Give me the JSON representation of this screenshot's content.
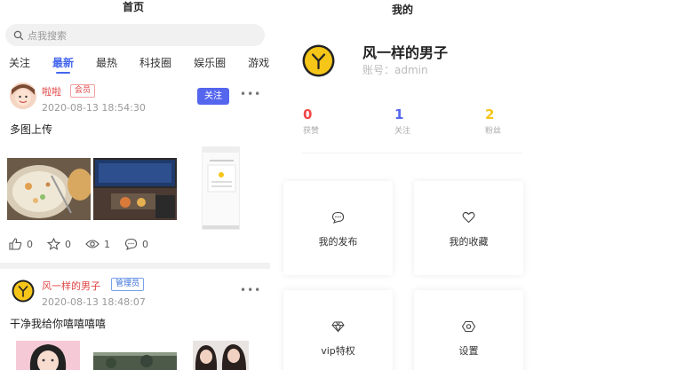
{
  "home": {
    "title": "首页",
    "search_placeholder": "点我搜索",
    "tabs": [
      "关注",
      "最新",
      "最热",
      "科技圈",
      "娱乐圈",
      "游戏"
    ],
    "active_tab": "最新",
    "posts": [
      {
        "user": "啦啦",
        "badge": "会员",
        "time": "2020-08-13 18:54:30",
        "follow_label": "关注",
        "more": "•••",
        "content": "多图上传",
        "likes": "0",
        "stars": "0",
        "views": "1",
        "comments": "0"
      },
      {
        "user": "风一样的男子",
        "badge": "管理员",
        "time": "2020-08-13 18:48:07",
        "more": "•••",
        "content": "干净我给你嘻嘻嘻嘻"
      }
    ]
  },
  "mine": {
    "title": "我的",
    "name": "风一样的男子",
    "account": "账号：admin",
    "stats": [
      {
        "value": "0",
        "label": "获赞",
        "color": "#f04848"
      },
      {
        "value": "1",
        "label": "关注",
        "color": "#5566ee"
      },
      {
        "value": "2",
        "label": "粉丝",
        "color": "#f5c518"
      }
    ],
    "cards": [
      "我的发布",
      "我的收藏",
      "vip特权",
      "设置"
    ]
  },
  "colors": {
    "accent": "#4466ee",
    "follow": "#5566ee",
    "username": "#e04444",
    "logo_yellow": "#f5c518"
  }
}
